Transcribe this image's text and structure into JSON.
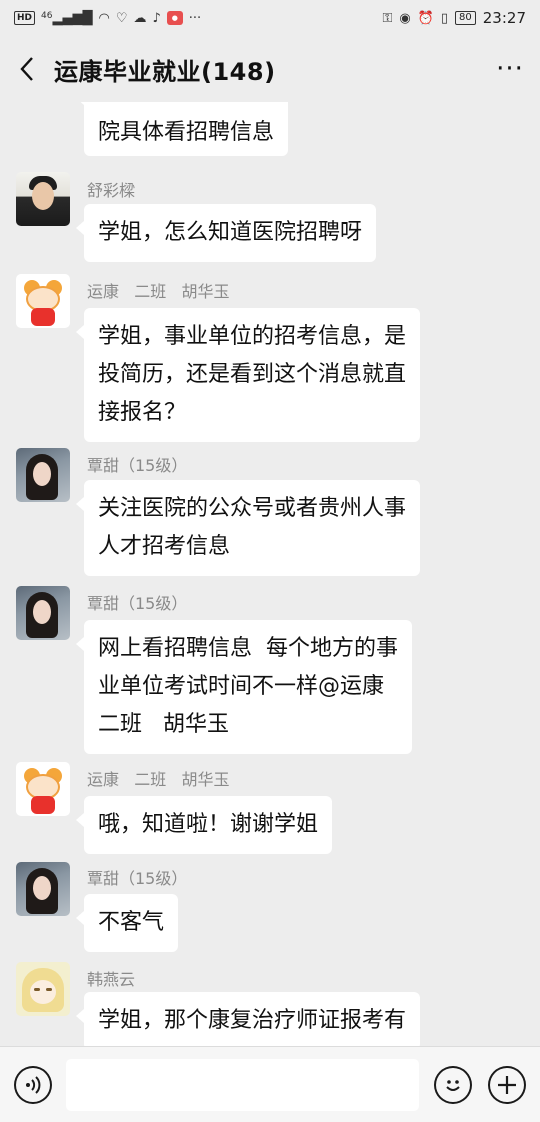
{
  "status_bar": {
    "left_icons": [
      "hd-icon",
      "signal-4g-icon",
      "wifi-icon",
      "heart-rate-icon",
      "cloud-icon",
      "notification-bell-icon",
      "app-badge-icon",
      "more-dots-icon"
    ],
    "network": "46",
    "battery": "80",
    "time": "23:27"
  },
  "header": {
    "back_glyph": "<",
    "title": "运康毕业就业(148)",
    "more_glyph": "···"
  },
  "messages": [
    {
      "sender": "",
      "lines": [
        "院具体看招聘信息"
      ],
      "avatar": ""
    },
    {
      "sender": "舒彩樑",
      "lines": [
        "学姐，怎么知道医院招聘呀"
      ],
      "avatar": "male-photo"
    },
    {
      "sender": "运康   二班   胡华玉",
      "lines": [
        "学姐，事业单位的招考信息，是",
        "投简历，还是看到这个消息就直",
        "接报名？"
      ],
      "avatar": "rat-cartoon"
    },
    {
      "sender": "覃甜（15级）",
      "lines": [
        "关注医院的公众号或者贵州人事",
        "人才招考信息"
      ],
      "avatar": "girl-photo"
    },
    {
      "sender": "覃甜（15级）",
      "lines": [
        "网上看招聘信息  每个地方的事",
        "业单位考试时间不一样@运康",
        "二班   胡华玉"
      ],
      "avatar": "girl-photo"
    },
    {
      "sender": "运康   二班   胡华玉",
      "lines": [
        "哦，知道啦！谢谢学姐"
      ],
      "avatar": "rat-cartoon"
    },
    {
      "sender": "覃甜（15级）",
      "lines": [
        "不客气"
      ],
      "avatar": "girl-photo"
    },
    {
      "sender": "韩燕云",
      "lines": [
        "学姐，那个康复治疗师证报考有"
      ],
      "avatar": "anime-girl"
    }
  ],
  "input_bar": {
    "voice_icon": "voice-icon",
    "placeholder": "",
    "emoji_icon": "emoji-icon",
    "plus_icon": "plus-icon"
  },
  "colors": {
    "background": "#ededed",
    "bubble": "#ffffff",
    "sender_text": "#8a8a8a",
    "app_badge": "#e84f4f"
  }
}
